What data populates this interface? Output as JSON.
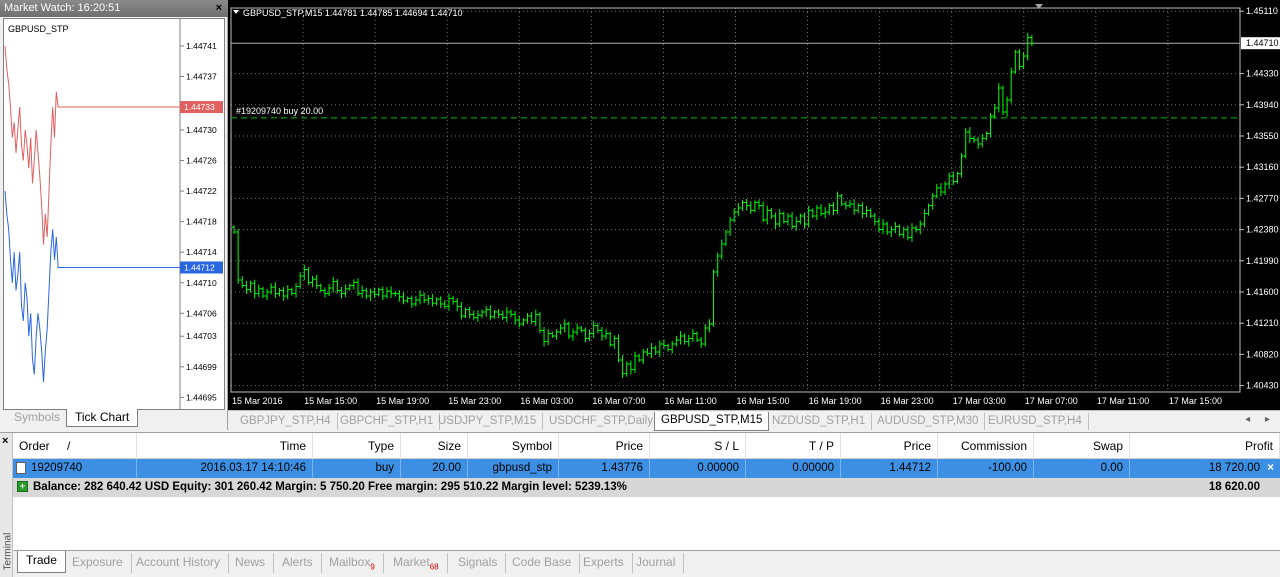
{
  "market_watch": {
    "title": "Market Watch: 16:20:51",
    "close": "×",
    "symbol": "GBPUSD_STP",
    "ask_price": "1.44733",
    "bid_price": "1.44712",
    "price_scale": [
      "1.44741",
      "1.44737",
      "1.44733",
      "1.44730",
      "1.44726",
      "1.44722",
      "1.44718",
      "1.44714",
      "1.44712",
      "1.44710",
      "1.44706",
      "1.44703",
      "1.44699",
      "1.44695"
    ],
    "tabs": [
      "Symbols",
      "Tick Chart"
    ],
    "ask_color": "#e06060",
    "bid_color": "#2a66e0",
    "ask_ticks": [
      1.44741,
      1.44738,
      1.44736,
      1.44733,
      1.44729,
      1.44731,
      1.44727,
      1.4473,
      1.44733,
      1.44728,
      1.44726,
      1.4473,
      1.44728,
      1.44725,
      1.44729,
      1.44723,
      1.44726,
      1.4473,
      1.44727,
      1.44724,
      1.4472,
      1.44715,
      1.44719,
      1.44716,
      1.44722,
      1.44728,
      1.44733,
      1.44729,
      1.44735,
      1.44733,
      1.44733
    ],
    "bid_ticks": [
      1.44722,
      1.44719,
      1.44717,
      1.44713,
      1.4471,
      1.44714,
      1.44709,
      1.44711,
      1.44714,
      1.44707,
      1.44705,
      1.4471,
      1.44708,
      1.44703,
      1.44706,
      1.447,
      1.44698,
      1.44703,
      1.44706,
      1.44704,
      1.44701,
      1.44697,
      1.44701,
      1.44704,
      1.44709,
      1.44714,
      1.44717,
      1.44713,
      1.44716,
      1.44712,
      1.44712
    ]
  },
  "chart": {
    "title": "GBPUSD_STP,M15  1.44781 1.44785 1.44694 1.44710",
    "order_line_label": "#19209740 buy 20.00",
    "order_price": 1.43776,
    "current_price": 1.4471,
    "current_price_label": "1.44710",
    "y_min": 1.4035,
    "y_max": 1.4515,
    "y_ticks": [
      "1.45110",
      "1.44330",
      "1.43940",
      "1.43550",
      "1.43160",
      "1.42770",
      "1.42380",
      "1.41990",
      "1.41600",
      "1.41210",
      "1.40820",
      "1.40430"
    ],
    "x_ticks": [
      "15 Mar 2016",
      "15 Mar 15:00",
      "15 Mar 19:00",
      "15 Mar 23:00",
      "16 Mar 03:00",
      "16 Mar 07:00",
      "16 Mar 11:00",
      "16 Mar 15:00",
      "16 Mar 19:00",
      "16 Mar 23:00",
      "17 Mar 03:00",
      "17 Mar 07:00",
      "17 Mar 11:00",
      "17 Mar 15:00"
    ],
    "bar_color": "#00ff00",
    "grid_color": "#707070",
    "closes": [
      1.4235,
      1.4175,
      1.4168,
      1.4163,
      1.4171,
      1.4158,
      1.4164,
      1.4155,
      1.416,
      1.4166,
      1.4158,
      1.4162,
      1.4155,
      1.4163,
      1.4158,
      1.4167,
      1.418,
      1.4188,
      1.4172,
      1.4176,
      1.4168,
      1.4162,
      1.4158,
      1.4165,
      1.4173,
      1.4162,
      1.4158,
      1.4164,
      1.4168,
      1.4172,
      1.4158,
      1.4162,
      1.4155,
      1.416,
      1.4157,
      1.4163,
      1.4155,
      1.4161,
      1.4158,
      1.4158,
      1.4154,
      1.4149,
      1.4152,
      1.4145,
      1.415,
      1.4156,
      1.415,
      1.4152,
      1.4146,
      1.4151,
      1.4145,
      1.4142,
      1.4152,
      1.4148,
      1.4142,
      1.413,
      1.4138,
      1.4132,
      1.4128,
      1.4131,
      1.4135,
      1.4138,
      1.4129,
      1.4135,
      1.4132,
      1.4128,
      1.4135,
      1.4132,
      1.4125,
      1.412,
      1.4125,
      1.413,
      1.4123,
      1.4132,
      1.4112,
      1.4098,
      1.4108,
      1.4105,
      1.411,
      1.4115,
      1.412,
      1.4105,
      1.411,
      1.4115,
      1.4112,
      1.4102,
      1.4108,
      1.4118,
      1.4112,
      1.4105,
      1.4108,
      1.4094,
      1.4102,
      1.4075,
      1.4058,
      1.407,
      1.4063,
      1.408,
      1.4075,
      1.4085,
      1.4083,
      1.409,
      1.4085,
      1.4095,
      1.4093,
      1.4088,
      1.4095,
      1.41,
      1.4105,
      1.4098,
      1.4102,
      1.4108,
      1.41,
      1.4095,
      1.4115,
      1.412,
      1.4185,
      1.4205,
      1.422,
      1.4235,
      1.425,
      1.426,
      1.4265,
      1.4272,
      1.4268,
      1.4262,
      1.4272,
      1.4268,
      1.425,
      1.4262,
      1.4255,
      1.4245,
      1.4258,
      1.4248,
      1.4255,
      1.4242,
      1.4248,
      1.4255,
      1.4245,
      1.4262,
      1.4255,
      1.4265,
      1.4258,
      1.426,
      1.4268,
      1.4262,
      1.428,
      1.427,
      1.4268,
      1.427,
      1.4262,
      1.4268,
      1.4258,
      1.4262,
      1.4255,
      1.4248,
      1.4238,
      1.4245,
      1.4235,
      1.4238,
      1.4242,
      1.4232,
      1.4238,
      1.4228,
      1.424,
      1.4238,
      1.4245,
      1.4258,
      1.4268,
      1.428,
      1.429,
      1.4285,
      1.4295,
      1.4305,
      1.4298,
      1.4308,
      1.433,
      1.436,
      1.4352,
      1.435,
      1.4345,
      1.4352,
      1.4358,
      1.438,
      1.439,
      1.4415,
      1.4385,
      1.44,
      1.4435,
      1.446,
      1.4442,
      1.4455,
      1.4478,
      1.4471
    ]
  },
  "chart_tabs": [
    "GBPJPY_STP,H4",
    "GBPCHF_STP,H1",
    "USDJPY_STP,M15",
    "USDCHF_STP,Daily",
    "GBPUSD_STP,M15",
    "NZDUSD_STP,H1",
    "AUDUSD_STP,M30",
    "EURUSD_STP,H4"
  ],
  "chart_tab_arrows": "◂ ▸",
  "terminal": {
    "side_label": "Terminal",
    "close": "×",
    "headers": [
      "Order",
      "/",
      "Time",
      "Type",
      "Size",
      "Symbol",
      "Price",
      "S / L",
      "T / P",
      "Price",
      "Commission",
      "Swap",
      "Profit"
    ],
    "order": {
      "order": "19209740",
      "time": "2016.03.17 14:10:46",
      "type": "buy",
      "size": "20.00",
      "symbol": "gbpusd_stp",
      "price": "1.43776",
      "sl": "0.00000",
      "tp": "0.00000",
      "cur_price": "1.44712",
      "commission": "-100.00",
      "swap": "0.00",
      "profit": "18 720.00",
      "close": "×"
    },
    "balance_line": "Balance: 282 640.42 USD  Equity: 301 260.42  Margin: 5 750.20  Free margin: 295 510.22  Margin level: 5239.13%",
    "balance_profit": "18 620.00",
    "tabs": [
      {
        "label": "Trade"
      },
      {
        "label": "Exposure"
      },
      {
        "label": "Account History"
      },
      {
        "label": "News"
      },
      {
        "label": "Alerts"
      },
      {
        "label": "Mailbox",
        "badge": "9"
      },
      {
        "label": "Market",
        "badge": "68"
      },
      {
        "label": "Signals"
      },
      {
        "label": "Code Base"
      },
      {
        "label": "Experts"
      },
      {
        "label": "Journal"
      }
    ]
  }
}
